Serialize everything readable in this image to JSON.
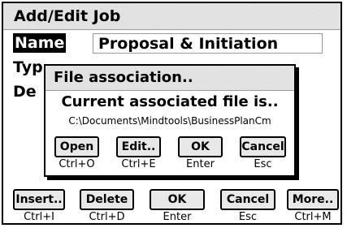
{
  "window": {
    "title": "Add/Edit Job",
    "fields": {
      "name_label": "Name",
      "name_value": "Proposal & Initiation",
      "type_label": "Typ",
      "desc_label": "De"
    },
    "buttons": [
      {
        "label": "Insert..",
        "shortcut": "Ctrl+I"
      },
      {
        "label": "Delete",
        "shortcut": "Ctrl+D"
      },
      {
        "label": "OK",
        "shortcut": "Enter"
      },
      {
        "label": "Cancel",
        "shortcut": "Esc"
      },
      {
        "label": "More..",
        "shortcut": "Ctrl+M"
      }
    ]
  },
  "dialog": {
    "title": "File association..",
    "message": "Current associated file is..",
    "path": "C:\\Documents\\Mindtools\\BusinessPlanCm",
    "buttons": [
      {
        "label": "Open",
        "shortcut": "Ctrl+O"
      },
      {
        "label": "Edit..",
        "shortcut": "Ctrl+E"
      },
      {
        "label": "OK",
        "shortcut": "Enter"
      },
      {
        "label": "Cancel",
        "shortcut": "Esc"
      }
    ]
  }
}
